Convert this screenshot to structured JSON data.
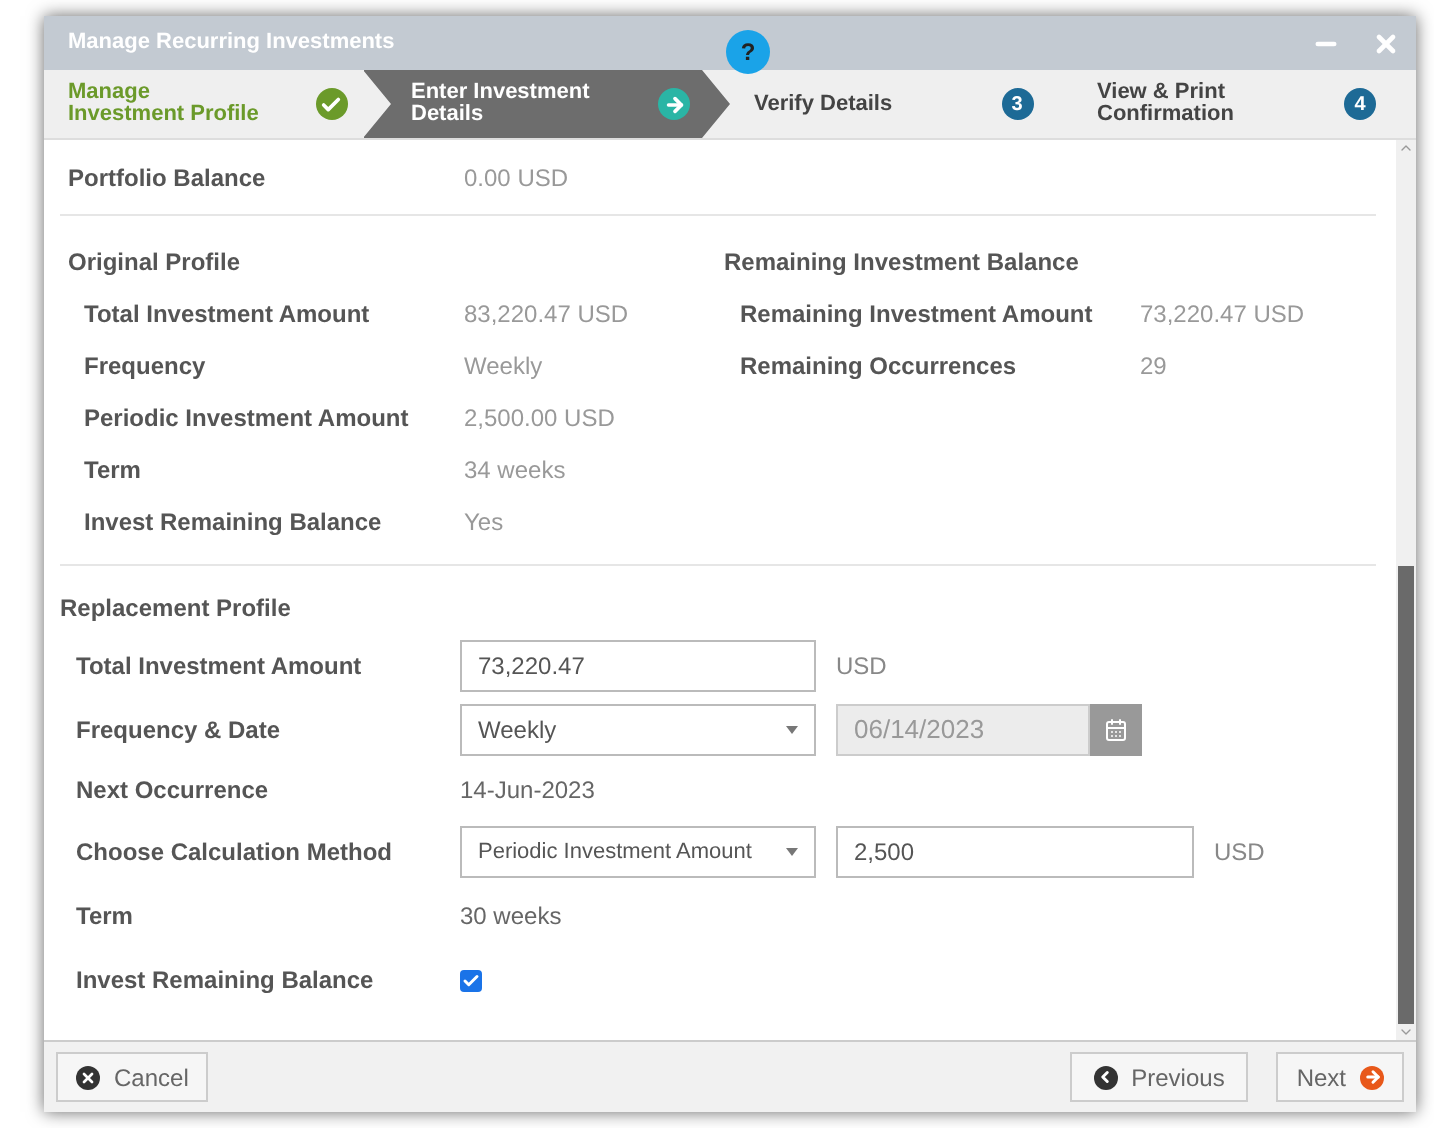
{
  "window": {
    "title": "Manage Recurring Investments",
    "help": "?"
  },
  "steps": [
    {
      "label": "Manage Investment Profile",
      "done": true,
      "selected": false
    },
    {
      "label": "Enter Investment Details",
      "done": false,
      "selected": true
    },
    {
      "label": "Verify Details",
      "done": false,
      "selected": false,
      "number": "3"
    },
    {
      "label": "View & Print Confirmation",
      "done": false,
      "selected": false,
      "number": "4"
    }
  ],
  "portfolio_balance": {
    "label": "Portfolio Balance",
    "value": "0.00 USD"
  },
  "original_profile": {
    "title": "Original Profile",
    "rows": [
      {
        "label": "Total Investment Amount",
        "value": "83,220.47 USD"
      },
      {
        "label": "Frequency",
        "value": "Weekly"
      },
      {
        "label": "Periodic Investment Amount",
        "value": "2,500.00 USD"
      },
      {
        "label": "Term",
        "value": "34 weeks"
      },
      {
        "label": "Invest Remaining Balance",
        "value": "Yes"
      }
    ]
  },
  "remaining_balance": {
    "title": "Remaining Investment Balance",
    "rows": [
      {
        "label": "Remaining Investment Amount",
        "value": "73,220.47 USD"
      },
      {
        "label": "Remaining Occurrences",
        "value": "29"
      }
    ]
  },
  "replacement_profile": {
    "title": "Replacement Profile",
    "total": {
      "label": "Total Investment Amount",
      "value": "73,220.47",
      "unit": "USD"
    },
    "frequency": {
      "label": "Frequency & Date",
      "value": "Weekly",
      "date": "06/14/2023"
    },
    "next": {
      "label": "Next Occurrence",
      "value": "14-Jun-2023"
    },
    "method": {
      "label": "Choose Calculation Method",
      "value": "Periodic Investment Amount",
      "amount": "2,500",
      "unit": "USD"
    },
    "term": {
      "label": "Term",
      "value": "30 weeks"
    },
    "invest_remaining": {
      "label": "Invest Remaining Balance",
      "checked": true
    }
  },
  "footer": {
    "cancel": "Cancel",
    "previous": "Previous",
    "next": "Next"
  }
}
